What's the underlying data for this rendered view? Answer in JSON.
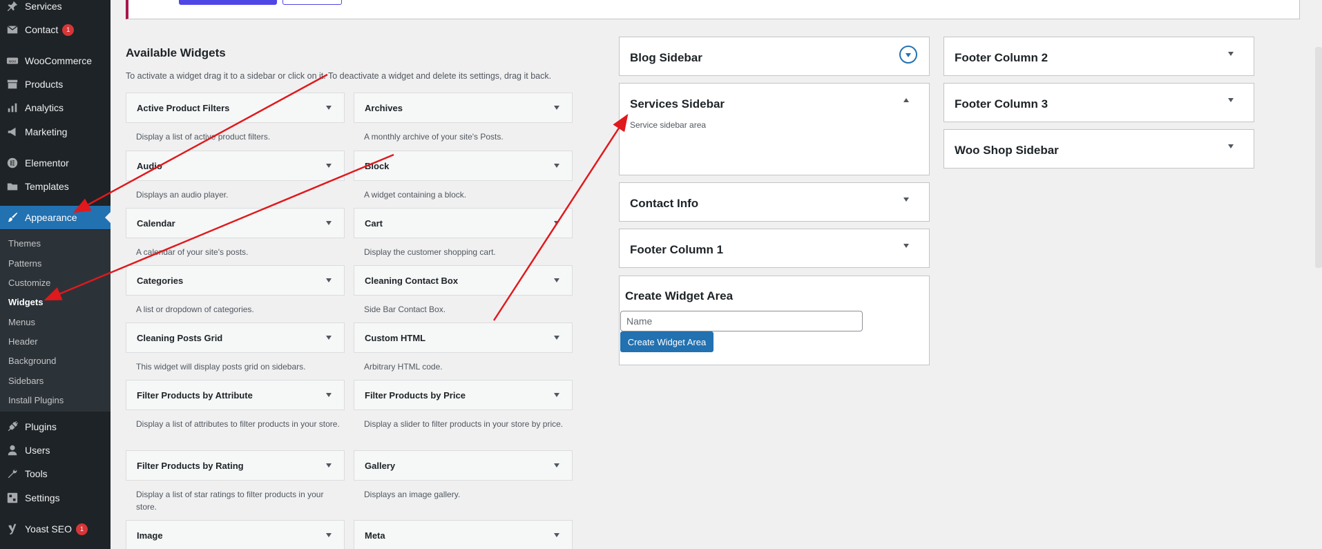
{
  "admin_menu": {
    "services": "Services",
    "contact": "Contact",
    "contact_badge": "1",
    "woocommerce": "WooCommerce",
    "products": "Products",
    "analytics": "Analytics",
    "marketing": "Marketing",
    "elementor": "Elementor",
    "templates": "Templates",
    "appearance": "Appearance",
    "plugins": "Plugins",
    "users": "Users",
    "tools": "Tools",
    "settings": "Settings",
    "yoast": "Yoast SEO",
    "yoast_badge": "1"
  },
  "appearance_submenu": {
    "themes": "Themes",
    "patterns": "Patterns",
    "customize": "Customize",
    "widgets": "Widgets",
    "menus": "Menus",
    "header": "Header",
    "background": "Background",
    "sidebars": "Sidebars",
    "install_plugins": "Install Plugins"
  },
  "available_widgets": {
    "title": "Available Widgets",
    "description": "To activate a widget drag it to a sidebar or click on it. To deactivate a widget and delete its settings, drag it back.",
    "widgets": [
      {
        "title": "Active Product Filters",
        "desc": "Display a list of active product filters."
      },
      {
        "title": "Archives",
        "desc": "A monthly archive of your site's Posts."
      },
      {
        "title": "Audio",
        "desc": "Displays an audio player."
      },
      {
        "title": "Block",
        "desc": "A widget containing a block."
      },
      {
        "title": "Calendar",
        "desc": "A calendar of your site's posts."
      },
      {
        "title": "Cart",
        "desc": "Display the customer shopping cart."
      },
      {
        "title": "Categories",
        "desc": "A list or dropdown of categories."
      },
      {
        "title": "Cleaning Contact Box",
        "desc": "Side Bar Contact Box."
      },
      {
        "title": "Cleaning Posts Grid",
        "desc": "This widget will display posts grid on sidebars."
      },
      {
        "title": "Custom HTML",
        "desc": "Arbitrary HTML code."
      },
      {
        "title": "Filter Products by Attribute",
        "desc": "Display a list of attributes to filter products in your store."
      },
      {
        "title": "Filter Products by Price",
        "desc": "Display a slider to filter products in your store by price."
      },
      {
        "title": "Filter Products by Rating",
        "desc": "Display a list of star ratings to filter products in your store."
      },
      {
        "title": "Gallery",
        "desc": "Displays an image gallery."
      },
      {
        "title": "Image",
        "desc": ""
      },
      {
        "title": "Meta",
        "desc": ""
      }
    ]
  },
  "sidebars": {
    "blog": "Blog Sidebar",
    "services": "Services Sidebar",
    "services_desc": "Service sidebar area",
    "contact_info": "Contact Info",
    "footer1": "Footer Column 1",
    "footer2": "Footer Column 2",
    "footer3": "Footer Column 3",
    "woo_shop": "Woo Shop Sidebar"
  },
  "create_widget_area": {
    "title": "Create Widget Area",
    "placeholder": "Name",
    "button": "Create Widget Area"
  },
  "colors": {
    "admin_bg": "#1d2327",
    "accent": "#2271b1",
    "badge": "#d63638",
    "annotation_arrow": "#e0191c"
  }
}
